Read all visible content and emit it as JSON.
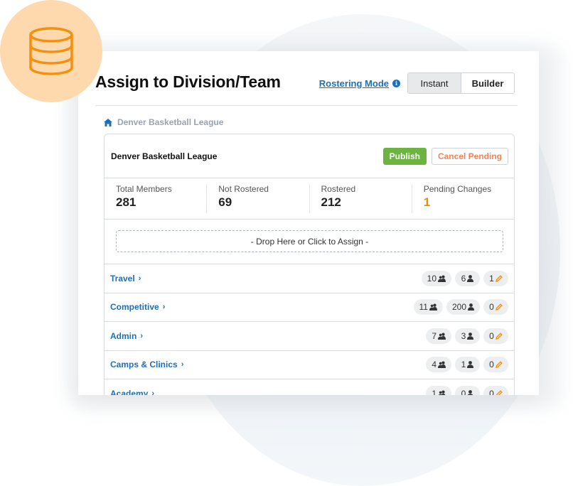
{
  "header": {
    "title": "Assign to Division/Team",
    "rostering_mode_label": "Rostering Mode",
    "info_icon": "info-circle-icon",
    "mode_options": [
      {
        "label": "Instant",
        "active": true
      },
      {
        "label": "Builder",
        "active": false
      }
    ]
  },
  "decor": {
    "badge_icon": "database-icon",
    "badge_color": "#fdd9ad",
    "badge_icon_color": "#f5900f"
  },
  "breadcrumb": {
    "icon": "home-icon",
    "label": "Denver Basketball League"
  },
  "panel": {
    "title": "Denver Basketball League",
    "publish_label": "Publish",
    "cancel_label": "Cancel Pending",
    "stats": [
      {
        "label": "Total Members",
        "value": "281"
      },
      {
        "label": "Not Rostered",
        "value": "69"
      },
      {
        "label": "Rostered",
        "value": "212"
      },
      {
        "label": "Pending Changes",
        "value": "1"
      }
    ],
    "drop_zone_label": "- Drop Here or Click to Assign -",
    "divisions": [
      {
        "name": "Travel",
        "teams": "10",
        "members": "6",
        "pending": "1"
      },
      {
        "name": "Competitive",
        "teams": "11",
        "members": "200",
        "pending": "0"
      },
      {
        "name": "Admin",
        "teams": "7",
        "members": "3",
        "pending": "0"
      },
      {
        "name": "Camps & Clinics",
        "teams": "4",
        "members": "1",
        "pending": "0"
      },
      {
        "name": "Academy",
        "teams": "1",
        "members": "0",
        "pending": "0"
      }
    ]
  },
  "colors": {
    "link": "#1f6fb5",
    "publish": "#6cb33f",
    "cancel": "#f0845a",
    "pending": "#f08a00"
  }
}
